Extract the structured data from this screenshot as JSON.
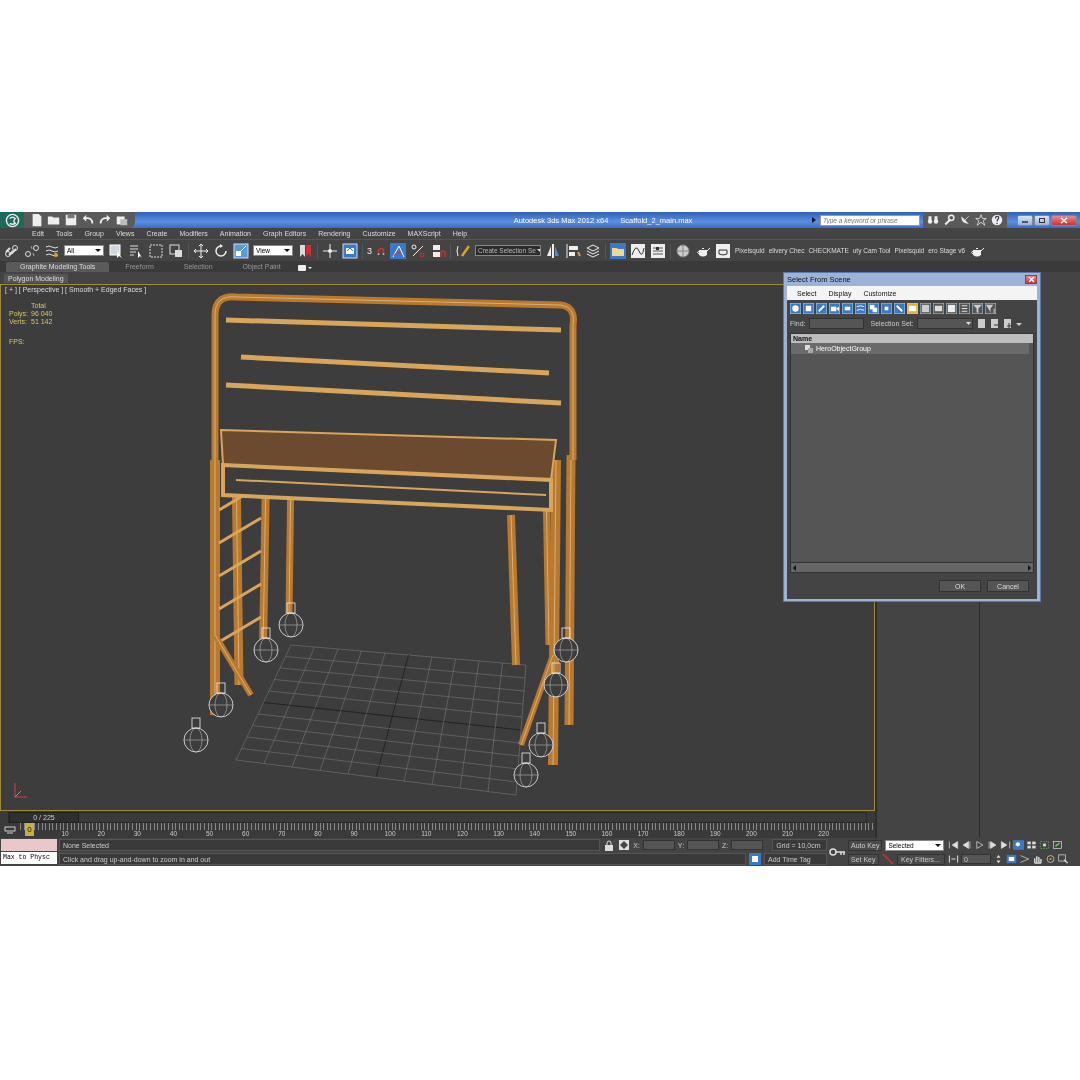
{
  "title_bar": {
    "app_title": "Autodesk 3ds Max  2012 x64",
    "file_name": "Scaffold_2_main.max",
    "search": {
      "placeholder": "Type a keyword or phrase"
    }
  },
  "menu": [
    "Edit",
    "Tools",
    "Group",
    "Views",
    "Create",
    "Modifiers",
    "Animation",
    "Graph Editors",
    "Rendering",
    "Customize",
    "MAXScript",
    "Help"
  ],
  "main_toolbar": {
    "selection_filter": "All",
    "reference_coordinate": "View",
    "snap_label": "3",
    "named_selection": "Create Selection Se",
    "plugins": [
      "Pixelsquid",
      "elivery Chec",
      "CHECKMATE",
      "uty Cam Tool",
      "Pixelsquid",
      "ero Stage v6"
    ]
  },
  "ribbon": {
    "tabs": [
      {
        "label": "Graphite Modeling Tools",
        "selected": true
      },
      {
        "label": "Freeform",
        "selected": false
      },
      {
        "label": "Selection",
        "selected": false
      },
      {
        "label": "Object Paint",
        "selected": false
      }
    ],
    "panel": "Polygon Modeling"
  },
  "viewport": {
    "label": "[ + ] [ Perspective ] [ Smooth + Edged Faces ]",
    "stats_header": "Total",
    "stats": [
      {
        "label": "Polys:",
        "value": "96 040"
      },
      {
        "label": "Verts:",
        "value": "51 142"
      }
    ],
    "fps": "FPS:"
  },
  "dialog": {
    "title": "Select From Scene",
    "menu": [
      "Select",
      "Display",
      "Customize"
    ],
    "find_label": "Find:",
    "selection_set_label": "Selection Set:",
    "column": "Name",
    "rows": [
      {
        "name": "HeroObjectGroup",
        "selected": true
      }
    ],
    "buttons": [
      "OK",
      "Cancel"
    ]
  },
  "time_slider": {
    "label": "0 / 225"
  },
  "ruler": {
    "current": "0",
    "ticks": [
      "10",
      "20",
      "30",
      "40",
      "50",
      "60",
      "70",
      "80",
      "90",
      "100",
      "110",
      "120",
      "130",
      "140",
      "150",
      "160",
      "170",
      "180",
      "190",
      "200",
      "210",
      "220"
    ]
  },
  "status": {
    "listener": "Max to Physc",
    "selection": "None Selected",
    "prompt": "Click and drag up-and-down to zoom in and out",
    "axes": [
      "X:",
      "Y:",
      "Z:"
    ],
    "grid": "Grid = 10,0cm",
    "time_tag": "Add Time Tag"
  },
  "animation": {
    "auto_key": "Auto Key",
    "set_key": "Set Key",
    "key_mode": "Selected",
    "key_filters": "Key Filters...",
    "frame": "0"
  }
}
